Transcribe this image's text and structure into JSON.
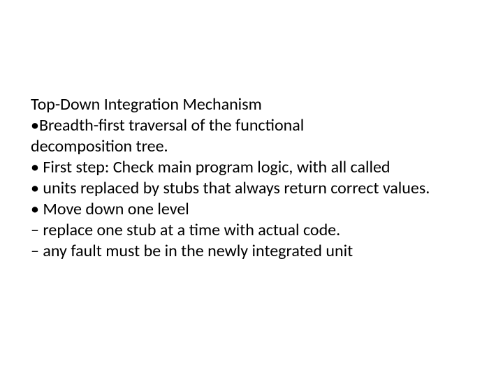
{
  "slide": {
    "title": "Top-Down Integration Mechanism",
    "lines": [
      "•Breadth-first traversal of the functional",
      "decomposition tree.",
      "• First step: Check main program logic, with all called",
      "•  units replaced by stubs that always return correct values.",
      "• Move down one level",
      "– replace one stub at a time with actual code.",
      "– any fault must be in the newly integrated unit"
    ]
  }
}
